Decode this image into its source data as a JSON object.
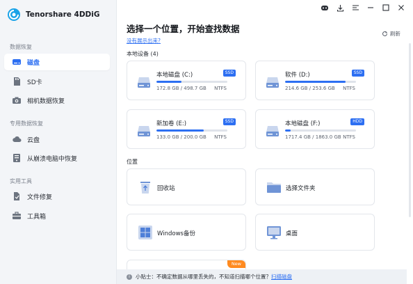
{
  "app": {
    "name": "Tenorshare 4DDiG"
  },
  "sidebar": {
    "sections": [
      {
        "title": "数据恢复",
        "items": [
          {
            "label": "磁盘",
            "icon": "disk-icon",
            "active": true
          },
          {
            "label": "SD卡",
            "icon": "sd-card-icon"
          },
          {
            "label": "相机数据恢复",
            "icon": "camera-icon"
          }
        ]
      },
      {
        "title": "专用数据恢复",
        "items": [
          {
            "label": "云盘",
            "icon": "cloud-icon"
          },
          {
            "label": "从崩溃电脑中恢复",
            "icon": "crashed-pc-icon"
          }
        ]
      },
      {
        "title": "实用工具",
        "items": [
          {
            "label": "文件修复",
            "icon": "file-repair-icon"
          },
          {
            "label": "工具箱",
            "icon": "toolbox-icon"
          }
        ]
      }
    ]
  },
  "main": {
    "title": "选择一个位置，开始查找数据",
    "help_link": "没有展示出来?",
    "refresh_label": "刷新",
    "local_devices_label": "本地设备 (4)",
    "drives": [
      {
        "name": "本地磁盘 (C:)",
        "type": "SSD",
        "usage": "172.8 GB / 498.7 GB",
        "fs": "NTFS",
        "used_fraction": 0.35
      },
      {
        "name": "软件 (D:)",
        "type": "SSD",
        "usage": "214.6 GB / 253.6 GB",
        "fs": "NTFS",
        "used_fraction": 0.85
      },
      {
        "name": "新加卷 (E:)",
        "type": "SSD",
        "usage": "133.0 GB / 200.0 GB",
        "fs": "NTFS",
        "used_fraction": 0.67
      },
      {
        "name": "本地磁盘 (F:)",
        "type": "HDD",
        "usage": "1717.4 GB / 1863.0 GB",
        "fs": "NTFS",
        "used_fraction": 0.08
      }
    ],
    "locations_label": "位置",
    "locations": [
      {
        "label": "回收站",
        "icon": "recycle-bin-icon"
      },
      {
        "label": "选择文件夹",
        "icon": "folder-icon"
      },
      {
        "label": "Windows备份",
        "icon": "windows-backup-icon"
      },
      {
        "label": "桌面",
        "icon": "desktop-icon"
      }
    ],
    "new_badge": "New"
  },
  "tip": {
    "prefix": "小贴士：不确定数据从哪里丢失的，不知道扫描哪个位置？",
    "link": "扫描磁盘"
  },
  "colors": {
    "accent": "#2d6ff2",
    "badge_new": "#ff8a1f",
    "sidebar_bg": "#f3f5f8"
  }
}
